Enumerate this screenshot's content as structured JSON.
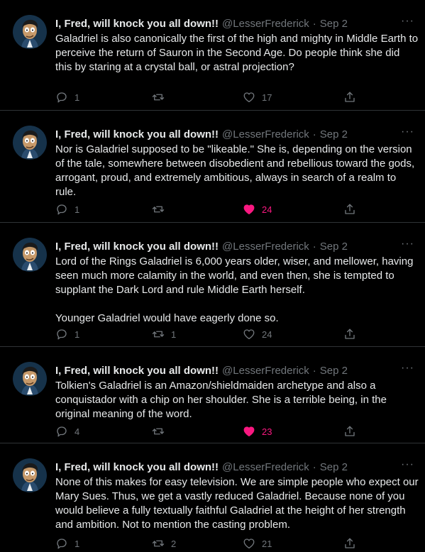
{
  "tweets": [
    {
      "name": "I, Fred, will knock you all down!!",
      "handle": "@LesserFrederick",
      "date": "Sep 2",
      "text": "Galadriel is also canonically the first of the high and mighty in Middle Earth to perceive the return of Sauron in the Second Age. Do people think she did this by staring at a crystal ball, or astral projection?",
      "replies": "1",
      "retweets": "",
      "likes": "17",
      "liked": false
    },
    {
      "name": "I, Fred, will knock you all down!!",
      "handle": "@LesserFrederick",
      "date": "Sep 2",
      "text": "Nor is Galadriel supposed to be \"likeable.\" She is, depending on the version of the tale, somewhere between disobedient and rebellious toward the gods, arrogant, proud, and extremely ambitious, always in search of a realm to rule.",
      "replies": "1",
      "retweets": "",
      "likes": "24",
      "liked": true
    },
    {
      "name": "I, Fred, will knock you all down!!",
      "handle": "@LesserFrederick",
      "date": "Sep 2",
      "text": "Lord of the Rings Galadriel is 6,000 years older, wiser, and mellower, having seen much more calamity in the world, and even then, she is tempted to supplant the Dark Lord and rule Middle Earth herself.\n\nYounger Galadriel would have eagerly done so.",
      "replies": "1",
      "retweets": "1",
      "likes": "24",
      "liked": false
    },
    {
      "name": "I, Fred, will knock you all down!!",
      "handle": "@LesserFrederick",
      "date": "Sep 2",
      "text": "Tolkien's Galadriel is an Amazon/shieldmaiden archetype and also a conquistador with a chip on her shoulder. She is a terrible being, in the original meaning of the word.",
      "replies": "4",
      "retweets": "",
      "likes": "23",
      "liked": true
    },
    {
      "name": "I, Fred, will knock you all down!!",
      "handle": "@LesserFrederick",
      "date": "Sep 2",
      "text": "None of this makes for easy television. We are simple people who expect our Mary Sues. Thus, we get a vastly reduced Galadriel. Because none of you would believe a fully textually faithful Galadriel at the height of her strength and ambition. Not to mention the casting problem.",
      "replies": "1",
      "retweets": "2",
      "likes": "21",
      "liked": false
    }
  ],
  "date_separator": "·",
  "more_glyph": "···",
  "colors": {
    "background": "#000000",
    "text": "#e7e9ea",
    "muted": "#71767b",
    "like": "#f91880",
    "border": "#2f3336"
  },
  "icons": {
    "reply": "reply-icon",
    "retweet": "retweet-icon",
    "like": "heart-icon",
    "share": "share-icon",
    "more": "more-icon"
  }
}
